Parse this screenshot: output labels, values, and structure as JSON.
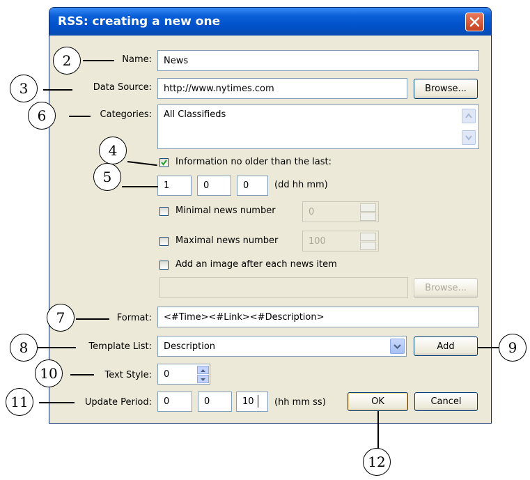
{
  "window": {
    "title": "RSS: creating a new one"
  },
  "fields": {
    "name": {
      "label": "Name:",
      "value": "News"
    },
    "data_source": {
      "label": "Data Source:",
      "value": "http://www.nytimes.com",
      "browse": "Browse..."
    },
    "categories": {
      "label": "Categories:",
      "value": "All Classifieds"
    },
    "info_older": {
      "label": "Information no older than the last:",
      "checked": true,
      "dd": "1",
      "hh": "0",
      "mm": "0",
      "unit": "(dd hh mm)"
    },
    "min_news": {
      "label": "Minimal news number",
      "checked": false,
      "value": "0"
    },
    "max_news": {
      "label": "Maximal news number",
      "checked": false,
      "value": "100"
    },
    "add_image": {
      "label": "Add an image after each news item",
      "checked": false,
      "value": "",
      "browse": "Browse..."
    },
    "format": {
      "label": "Format:",
      "value": "<#Time><#Link><#Description>"
    },
    "template_list": {
      "label": "Template List:",
      "value": "Description",
      "add": "Add"
    },
    "text_style": {
      "label": "Text Style:",
      "value": "0"
    },
    "update_period": {
      "label": "Update Period:",
      "hh": "0",
      "mm": "0",
      "ss": "10",
      "unit": "(hh mm ss)"
    }
  },
  "buttons": {
    "ok": "OK",
    "cancel": "Cancel"
  },
  "callouts": [
    "2",
    "3",
    "6",
    "4",
    "5",
    "7",
    "8",
    "9",
    "10",
    "11",
    "12"
  ],
  "colors": {
    "title_bar": "#0a5fd8",
    "close": "#c4411f",
    "dialog_bg": "#ece9d8",
    "check": "#21a121"
  }
}
